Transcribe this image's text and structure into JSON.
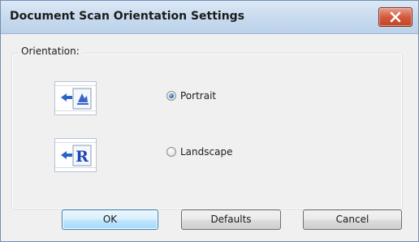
{
  "window": {
    "title": "Document Scan Orientation Settings",
    "close_icon": "close-x-icon"
  },
  "orientation_group": {
    "label": "Orientation:",
    "options": [
      {
        "label": "Portrait",
        "selected": true,
        "icon": "portrait-scan-icon"
      },
      {
        "label": "Landscape",
        "selected": false,
        "icon": "landscape-scan-icon"
      }
    ]
  },
  "buttons": {
    "ok": "OK",
    "defaults": "Defaults",
    "cancel": "Cancel"
  },
  "colors": {
    "titlebar": "#c7daee",
    "close_button": "#d45a3c",
    "icon_arrow": "#2a63c9",
    "ok_button": "#bee6fd",
    "dialog_background": "#f0f0f0"
  }
}
